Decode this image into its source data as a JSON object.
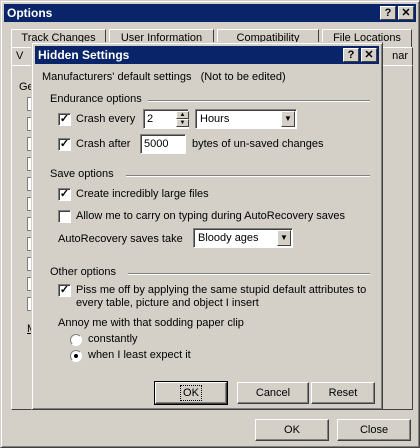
{
  "options": {
    "title": "Options",
    "tabs_back": [
      "Track Changes",
      "User Information",
      "Compatibility",
      "File Locations"
    ],
    "tabs_front_edges": [
      "V",
      "nar"
    ],
    "gen_label": "Gen",
    "m_label": "M",
    "ok": "OK",
    "close": "Close",
    "help_glyph": "?",
    "close_glyph": "✕"
  },
  "dialog": {
    "title": "Hidden Settings",
    "help_glyph": "?",
    "close_glyph": "✕",
    "subtitle": "Manufacturers' default settings",
    "subtitle_note": "(Not to be edited)",
    "endurance": {
      "heading": "Endurance options",
      "crash_every": {
        "label": "Crash every",
        "checked": true,
        "value": "2",
        "unit": "Hours"
      },
      "crash_after": {
        "label": "Crash after",
        "checked": true,
        "value": "5000",
        "suffix": "bytes of un-saved changes"
      }
    },
    "save": {
      "heading": "Save options",
      "large_files": {
        "label": "Create incredibly large files",
        "checked": true
      },
      "carry_on": {
        "label": "Allow me to carry on typing during AutoRecovery saves",
        "checked": false
      },
      "autorecovery_label": "AutoRecovery saves take",
      "autorecovery_value": "Bloody ages"
    },
    "other": {
      "heading": "Other options",
      "piss_line1": "Piss me off by applying the same stupid default attributes to",
      "piss_line2": "every table, picture and object I insert",
      "piss_checked": true,
      "annoy_label": "Annoy me with that sodding paper clip",
      "radio_constantly": "constantly",
      "radio_least": "when I least expect it",
      "selected": "when I least expect it"
    },
    "buttons": {
      "ok": "OK",
      "cancel": "Cancel",
      "reset": "Reset"
    },
    "check_glyph": "✓",
    "dropdown_glyph": "▼",
    "spin_up": "▲",
    "spin_down": "▼"
  }
}
